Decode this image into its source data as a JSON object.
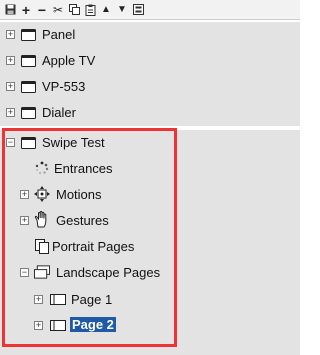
{
  "toolbar": {
    "buttons": [
      {
        "name": "save-icon"
      },
      {
        "name": "add-icon",
        "glyph": "+"
      },
      {
        "name": "remove-icon",
        "glyph": "−"
      },
      {
        "name": "cut-icon",
        "glyph": "✂"
      },
      {
        "name": "copy-icon"
      },
      {
        "name": "paste-icon"
      },
      {
        "name": "move-up-icon",
        "glyph": "▲"
      },
      {
        "name": "move-down-icon",
        "glyph": "▼"
      },
      {
        "name": "collapse-all-icon"
      }
    ]
  },
  "tree": {
    "items": [
      {
        "label": "Panel",
        "icon": "window-icon",
        "expanded": false
      },
      {
        "label": "Apple TV",
        "icon": "window-icon",
        "expanded": false
      },
      {
        "label": "VP-553",
        "icon": "window-icon",
        "expanded": false
      },
      {
        "label": "Dialer",
        "icon": "window-icon",
        "expanded": false
      },
      {
        "label": "Swipe Test",
        "icon": "window-icon",
        "expanded": true,
        "children": [
          {
            "label": "Entrances",
            "icon": "entrances-icon"
          },
          {
            "label": "Motions",
            "icon": "motions-icon",
            "expanded": false
          },
          {
            "label": "Gestures",
            "icon": "gestures-hand-icon",
            "expanded": false
          },
          {
            "label": "Portrait Pages",
            "icon": "portrait-pages-icon"
          },
          {
            "label": "Landscape Pages",
            "icon": "landscape-pages-icon",
            "expanded": true,
            "children": [
              {
                "label": "Page 1",
                "icon": "page-icon",
                "expanded": false
              },
              {
                "label": "Page 2",
                "icon": "page-icon",
                "expanded": false,
                "selected": true
              }
            ]
          }
        ]
      }
    ]
  },
  "colors": {
    "highlight": "#ee3333",
    "selection": "#1f5aa6",
    "row_background": "#e3e3e3"
  }
}
